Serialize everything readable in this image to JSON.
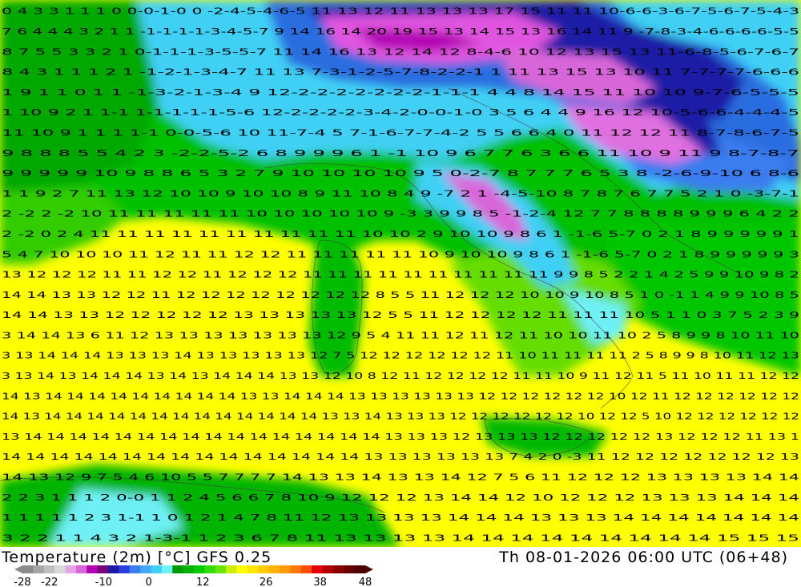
{
  "header": {
    "title": "Temperature (2m) [°C] GFS 0.25",
    "valid_time": "Th 08-01-2026 06:00 UTC (06+48)"
  },
  "legend": {
    "tick_labels": [
      "-28",
      "-22",
      "-10",
      "0",
      "12",
      "26",
      "38",
      "48"
    ],
    "colors": [
      "#8c8c8c",
      "#a6a6a6",
      "#bfbfbf",
      "#d9d9d9",
      "#e6a6e6",
      "#d966d9",
      "#b300b3",
      "#7a007a",
      "#1a1aa6",
      "#2c3de0",
      "#3c7df0",
      "#40a8f5",
      "#3fd0f5",
      "#6ef0f5",
      "#009900",
      "#00b300",
      "#00cc00",
      "#33dd00",
      "#66e600",
      "#ccf000",
      "#ffff00",
      "#ffe600",
      "#ffcc00",
      "#ffb300",
      "#ff9900",
      "#ff7a00",
      "#ff4d00",
      "#e60000",
      "#b30000",
      "#8b0000",
      "#660000",
      "#4d0000"
    ]
  },
  "map": {
    "value_rows": [
      "0 4 3 3 1 1 1 0 0-0-1-0 0 -2-4-5-4-6-5 11 13 12 11 13 13 13 17 15 11 11 10-6-6-3-6-7-5-6-7-5-4-3",
      "7 6 4 4 4 3 2 1 1 -1-1-1-1-3-4-5-7 9 14 16 14 20 19 15 13 14 15 13 16 14 11 9 -7-8-3-4-6-6-6-6-5-5",
      "8 7 5 5 3 3 2 1 0-1-1-1-3-5-5-7 11 14 16 13 12 14 12 8-4-6 10 12 13 15 13 11-6-8-5-6-7-6-7",
      "8 4 3 1 1 1 2 1 -1-2-1-3-4-7 11 13 7-3-1-2-5-7-8-2-2-1 1 11 13 15 13 10 11 7-7-7-7-6-6-6",
      "1 9 1 1 0 1 1 -1-3-2-1-3-4 9 12-2-2-2-2-2-2-2-1-1-1 4 4 8 14 15 11 10 10 9-7-6-5-5-5",
      "1 10 9 2 1 1-1 1-1-1-1-1-5-6 12-2-2-2-2-3-4-2-0-0-1-0 3 5 6 4 4 9 16 12 10-5-6-6-4-4-4-5",
      "11 10 9 1 1 1 1-1 0-0-5-6 10 11-7-4 5 7-1-6-7-7-4-2 5 5 6 6 4 0 11 12 12 11 8-7-8-6-7-5",
      "9 8 8 8 5 5 4 2 3 -2-2-5-2 6 8 9 9 9 6 1 -1 10 9 6 7 7 6 3 6 6 11 10 9 11 9 8-7-8-7",
      "9 9 9 9 9 10 9 8 8 6 5 3 2 7 9 10 10 10 10 9 5 0-2-7 8 7 7 7 6 5 3 8 -2-6-9-10 6 8-6",
      "1 1 9 2 7 11 13 12 10 10 9 10 10 8 9 11 10 8 4 9 -7 2 1 -4-5-10 8 7 8 7 6 7 7 5 2 1 0 -3-7-1",
      "2 -2 2 -2 10 11 11 11 11 11 10 10 10 10 10 9 -3 3 9 9 8 5 -1-2-4 12 7 7 8 8 8 8 9 9 9 6 4 2 2",
      "2 -2 0 2 4 11 11 11 11 11 11 11 11 11 11 10 10 2 9 10 10 9 8 6 1 -1-6 5-7 0 2 1 8 9 9 9 9 9 1",
      "5 4 7 10 10 10 11 12 11 11 12 12 11 11 11 11 11 10 9 10 10 9 8 6 1 -1-6 5-7 0 2 1 8 9 9 9 9 9 3",
      "13 12 12 12 11 11 12 12 11 12 12 12 11 11 11 11 11 11 11 11 11 11 9 9 8 5 2 2 1 4 2 5 9 9 10 9 8 2",
      "14 14 13 13 12 12 11 12 12 12 12 12 12 12 12 8 5 5 11 12 12 12 10 10 9 10 8 5 1 0 -1 1 4 9 9 10 8 5",
      "14 14 13 13 12 12 12 12 12 13 13 13 13 13 12 5 5 11 12 12 12 12 11 11 11 10 5 1 1 0 3 7 5 2 3 9",
      "3 14 14 13 6 11 12 13 13 13 13 13 13 13 12 9 5 4 11 11 12 11 12 11 10 10 11 10 2 5 8 9 9 8 10 11 10",
      "3 13 14 14 14 13 13 13 14 13 13 13 13 13 12 7 5 12 12 12 12 12 12 11 10 11 11 11 11 2 5 8 9 9 8 10 11 12 13",
      "3 13 14 13 14 14 14 13 14 13 14 14 14 13 13 12 10 8 12 11 12 12 12 12 11 11 10 9 11 12 11 5 11 10 11 11 12 12",
      "14 13 14 14 14 14 14 14 14 14 14 13 13 14 14 14 13 13 13 13 13 13 12 12 12 12 12 12 10 12 11 12 12 12 12 12 12",
      "14 13 14 14 14 14 14 14 14 14 14 14 14 14 14 13 13 14 13 13 13 12 12 12 12 12 12 10 12 12 5 10 12 12 12 12 12 12",
      "13 14 14 14 14 14 14 14 14 14 14 14 14 14 14 14 14 13 13 13 12 13 13 13 12 12 12 12 12 13 12 12 12 11 13 1",
      "14 14 14 14 14 14 14 14 14 14 14 14 14 14 14 13 13 13 13 13 13 7 4 2 0 -3 11 12 12 12 12 12 12 12 13",
      "14 13 12 9 7 5 4 6 10 5 5 7 7 7 7 14 13 13 14 13 13 14 12 7 5 6 11 12 12 12 13 13 13 13 14 14",
      "2 2 3 1 1 1 2 0-0 1 1 2 4 5 6 6 7 8 10 9 12 12 12 13 14 14 12 10 12 12 12 13 13 13 14 14 14",
      "1 1 1 1 1 2 3 1-1 1 0 1 2 1 4 7 8 11 12 13 13 13 13 14 14 14 13 13 13 14 14 14 14 14 14 14",
      "3 2 2 1 1 4 3 2 1-3-1 1 2 3 6 7 8 11 13 13 13 13 14 14 14 14 14 14 14 14 14 15 15 15"
    ]
  }
}
